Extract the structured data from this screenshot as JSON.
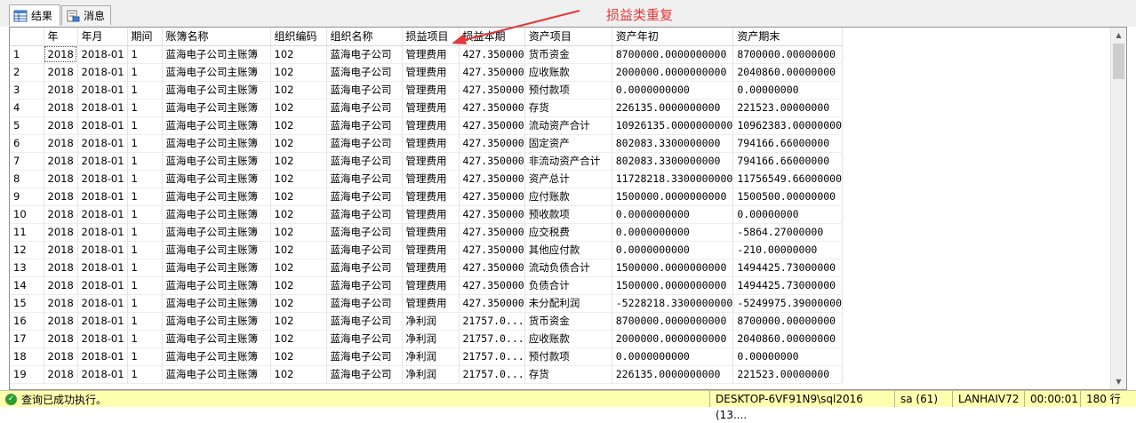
{
  "tabs": [
    {
      "label": "结果",
      "icon": "grid-icon",
      "active": true
    },
    {
      "label": "消息",
      "icon": "messages-icon",
      "active": false
    }
  ],
  "annotation": {
    "text": "损益类重复",
    "color": "#e03a3a"
  },
  "grid": {
    "columns": [
      "",
      "年",
      "年月",
      "期间",
      "账簿名称",
      "组织编码",
      "组织名称",
      "损益项目",
      "损益本期",
      "资产项目",
      "资产年初",
      "资产期末"
    ],
    "rows": [
      [
        "1",
        "2018",
        "2018-01",
        "1",
        "蓝海电子公司主账簿",
        "102",
        "蓝海电子公司",
        "管理费用",
        "427.350000",
        "货币资金",
        "8700000.0000000000",
        "8700000.00000000"
      ],
      [
        "2",
        "2018",
        "2018-01",
        "1",
        "蓝海电子公司主账簿",
        "102",
        "蓝海电子公司",
        "管理费用",
        "427.350000",
        "应收账款",
        "2000000.0000000000",
        "2040860.00000000"
      ],
      [
        "3",
        "2018",
        "2018-01",
        "1",
        "蓝海电子公司主账簿",
        "102",
        "蓝海电子公司",
        "管理费用",
        "427.350000",
        "预付款项",
        "0.0000000000",
        "0.00000000"
      ],
      [
        "4",
        "2018",
        "2018-01",
        "1",
        "蓝海电子公司主账簿",
        "102",
        "蓝海电子公司",
        "管理费用",
        "427.350000",
        "存货",
        "226135.0000000000",
        "221523.00000000"
      ],
      [
        "5",
        "2018",
        "2018-01",
        "1",
        "蓝海电子公司主账簿",
        "102",
        "蓝海电子公司",
        "管理费用",
        "427.350000",
        "流动资产合计",
        "10926135.0000000000",
        "10962383.00000000"
      ],
      [
        "6",
        "2018",
        "2018-01",
        "1",
        "蓝海电子公司主账簿",
        "102",
        "蓝海电子公司",
        "管理费用",
        "427.350000",
        "固定资产",
        "802083.3300000000",
        "794166.66000000"
      ],
      [
        "7",
        "2018",
        "2018-01",
        "1",
        "蓝海电子公司主账簿",
        "102",
        "蓝海电子公司",
        "管理费用",
        "427.350000",
        "非流动资产合计",
        "802083.3300000000",
        "794166.66000000"
      ],
      [
        "8",
        "2018",
        "2018-01",
        "1",
        "蓝海电子公司主账簿",
        "102",
        "蓝海电子公司",
        "管理费用",
        "427.350000",
        "资产总计",
        "11728218.3300000000",
        "11756549.66000000"
      ],
      [
        "9",
        "2018",
        "2018-01",
        "1",
        "蓝海电子公司主账簿",
        "102",
        "蓝海电子公司",
        "管理费用",
        "427.350000",
        "应付账款",
        "1500000.0000000000",
        "1500500.00000000"
      ],
      [
        "10",
        "2018",
        "2018-01",
        "1",
        "蓝海电子公司主账簿",
        "102",
        "蓝海电子公司",
        "管理费用",
        "427.350000",
        "预收款项",
        "0.0000000000",
        "0.00000000"
      ],
      [
        "11",
        "2018",
        "2018-01",
        "1",
        "蓝海电子公司主账簿",
        "102",
        "蓝海电子公司",
        "管理费用",
        "427.350000",
        "应交税费",
        "0.0000000000",
        "-5864.27000000"
      ],
      [
        "12",
        "2018",
        "2018-01",
        "1",
        "蓝海电子公司主账簿",
        "102",
        "蓝海电子公司",
        "管理费用",
        "427.350000",
        "其他应付款",
        "0.0000000000",
        "-210.00000000"
      ],
      [
        "13",
        "2018",
        "2018-01",
        "1",
        "蓝海电子公司主账簿",
        "102",
        "蓝海电子公司",
        "管理费用",
        "427.350000",
        "流动负债合计",
        "1500000.0000000000",
        "1494425.73000000"
      ],
      [
        "14",
        "2018",
        "2018-01",
        "1",
        "蓝海电子公司主账簿",
        "102",
        "蓝海电子公司",
        "管理费用",
        "427.350000",
        "负债合计",
        "1500000.0000000000",
        "1494425.73000000"
      ],
      [
        "15",
        "2018",
        "2018-01",
        "1",
        "蓝海电子公司主账簿",
        "102",
        "蓝海电子公司",
        "管理费用",
        "427.350000",
        "未分配利润",
        "-5228218.3300000000",
        "-5249975.39000000"
      ],
      [
        "16",
        "2018",
        "2018-01",
        "1",
        "蓝海电子公司主账簿",
        "102",
        "蓝海电子公司",
        "净利润",
        "21757.0...",
        "货币资金",
        "8700000.0000000000",
        "8700000.00000000"
      ],
      [
        "17",
        "2018",
        "2018-01",
        "1",
        "蓝海电子公司主账簿",
        "102",
        "蓝海电子公司",
        "净利润",
        "21757.0...",
        "应收账款",
        "2000000.0000000000",
        "2040860.00000000"
      ],
      [
        "18",
        "2018",
        "2018-01",
        "1",
        "蓝海电子公司主账簿",
        "102",
        "蓝海电子公司",
        "净利润",
        "21757.0...",
        "预付款项",
        "0.0000000000",
        "0.00000000"
      ],
      [
        "19",
        "2018",
        "2018-01",
        "1",
        "蓝海电子公司主账簿",
        "102",
        "蓝海电子公司",
        "净利润",
        "21757.0...",
        "存货",
        "226135.0000000000",
        "221523.00000000"
      ]
    ]
  },
  "status": {
    "message": "查询已成功执行。",
    "server": "DESKTOP-6VF91N9\\sql2016 (13....",
    "user": "sa (61)",
    "database": "LANHAIV72",
    "elapsed": "00:00:01",
    "rows": "180 行",
    "background": "#ffffb0"
  }
}
